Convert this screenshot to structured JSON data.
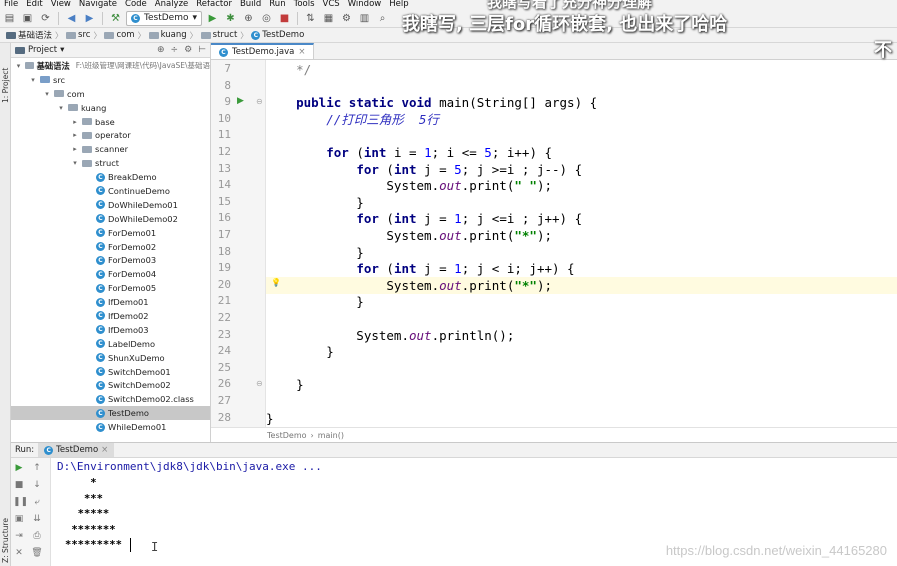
{
  "menu": [
    "File",
    "Edit",
    "View",
    "Navigate",
    "Code",
    "Analyze",
    "Refactor",
    "Build",
    "Run",
    "Tools",
    "VCS",
    "Window",
    "Help"
  ],
  "toolbar": {
    "run_config": "TestDemo"
  },
  "breadcrumb": [
    "基础语法",
    "src",
    "com",
    "kuang",
    "struct",
    "TestDemo"
  ],
  "sidebar_strip": {
    "project": "1: Project",
    "structure": "Z: Structure"
  },
  "project_pane": {
    "title": "Project",
    "root_name": "基础语法",
    "root_path": "F:\\班级管理\\网课班\\代码\\JavaSE\\基础语",
    "items": [
      {
        "label": "src",
        "depth": 1,
        "kind": "folder",
        "arrow": "open"
      },
      {
        "label": "com",
        "depth": 2,
        "kind": "package",
        "arrow": "open"
      },
      {
        "label": "kuang",
        "depth": 3,
        "kind": "package",
        "arrow": "open"
      },
      {
        "label": "base",
        "depth": 4,
        "kind": "package",
        "arrow": "closed"
      },
      {
        "label": "operator",
        "depth": 4,
        "kind": "package",
        "arrow": "closed"
      },
      {
        "label": "scanner",
        "depth": 4,
        "kind": "package",
        "arrow": "closed"
      },
      {
        "label": "struct",
        "depth": 4,
        "kind": "package",
        "arrow": "open"
      },
      {
        "label": "BreakDemo",
        "depth": 5,
        "kind": "class"
      },
      {
        "label": "ContinueDemo",
        "depth": 5,
        "kind": "class"
      },
      {
        "label": "DoWhileDemo01",
        "depth": 5,
        "kind": "class"
      },
      {
        "label": "DoWhileDemo02",
        "depth": 5,
        "kind": "class"
      },
      {
        "label": "ForDemo01",
        "depth": 5,
        "kind": "class"
      },
      {
        "label": "ForDemo02",
        "depth": 5,
        "kind": "class"
      },
      {
        "label": "ForDemo03",
        "depth": 5,
        "kind": "class"
      },
      {
        "label": "ForDemo04",
        "depth": 5,
        "kind": "class"
      },
      {
        "label": "ForDemo05",
        "depth": 5,
        "kind": "class"
      },
      {
        "label": "IfDemo01",
        "depth": 5,
        "kind": "class"
      },
      {
        "label": "IfDemo02",
        "depth": 5,
        "kind": "class"
      },
      {
        "label": "IfDemo03",
        "depth": 5,
        "kind": "class"
      },
      {
        "label": "LabelDemo",
        "depth": 5,
        "kind": "class"
      },
      {
        "label": "ShunXuDemo",
        "depth": 5,
        "kind": "class"
      },
      {
        "label": "SwitchDemo01",
        "depth": 5,
        "kind": "class"
      },
      {
        "label": "SwitchDemo02",
        "depth": 5,
        "kind": "class"
      },
      {
        "label": "SwitchDemo02.class",
        "depth": 5,
        "kind": "class"
      },
      {
        "label": "TestDemo",
        "depth": 5,
        "kind": "class",
        "selected": true
      },
      {
        "label": "WhileDemo01",
        "depth": 5,
        "kind": "class"
      }
    ]
  },
  "editor": {
    "tab_label": "TestDemo.java",
    "lines": [
      {
        "n": "7",
        "html": "    <span class=\"cm\">*/</span>"
      },
      {
        "n": "8",
        "html": ""
      },
      {
        "n": "9",
        "html": "    <span class=\"kw\">public static void</span> main(String[] args) {"
      },
      {
        "n": "10",
        "html": "        <span class=\"cmi\">//打印三角形  5行</span>"
      },
      {
        "n": "11",
        "html": ""
      },
      {
        "n": "12",
        "html": "        <span class=\"kw\">for</span> (<span class=\"kw\">int</span> i = <span class=\"num\">1</span>; i &lt;= <span class=\"num\">5</span>; i++) {"
      },
      {
        "n": "13",
        "html": "            <span class=\"kw\">for</span> (<span class=\"kw\">int</span> j = <span class=\"num\">5</span>; j &gt;=i ; j--) {"
      },
      {
        "n": "14",
        "html": "                System.<span class=\"fld\">out</span>.print(<span class=\"str\">\" \"</span>);"
      },
      {
        "n": "15",
        "html": "            }"
      },
      {
        "n": "16",
        "html": "            <span class=\"kw\">for</span> (<span class=\"kw\">int</span> j = <span class=\"num\">1</span>; j &lt;=i ; j++) {"
      },
      {
        "n": "17",
        "html": "                System.<span class=\"fld\">out</span>.print(<span class=\"str\">\"*\"</span>);"
      },
      {
        "n": "18",
        "html": "            }"
      },
      {
        "n": "19",
        "html": "            <span class=\"kw\">for</span> (<span class=\"kw\">int</span> j = <span class=\"num\">1</span>; j &lt; i; j++) {"
      },
      {
        "n": "20",
        "html": "                System.<span class=\"fld\">out</span>.print(<span class=\"str\">\"*\"</span>);",
        "highlight": true
      },
      {
        "n": "21",
        "html": "            }"
      },
      {
        "n": "22",
        "html": ""
      },
      {
        "n": "23",
        "html": "            System.<span class=\"fld\">out</span>.println();"
      },
      {
        "n": "24",
        "html": "        }"
      },
      {
        "n": "25",
        "html": ""
      },
      {
        "n": "26",
        "html": "    }"
      },
      {
        "n": "27",
        "html": ""
      },
      {
        "n": "28",
        "html": "}"
      }
    ],
    "status_crumbs": [
      "TestDemo",
      "main()"
    ]
  },
  "run_panel": {
    "label": "Run:",
    "tab": "TestDemo",
    "command": "D:\\Environment\\jdk8\\jdk\\bin\\java.exe ...",
    "output": [
      "    *",
      "   ***",
      "  *****",
      " *******",
      "*********"
    ]
  },
  "watermark": "https://blog.csdn.net/weixin_44165280",
  "subtitles": {
    "line1": "我瞎写, 三层for循环嵌套, 也出来了哈哈",
    "top_partial": "我瞎写着了充分神分理解",
    "right_partial": "不"
  }
}
